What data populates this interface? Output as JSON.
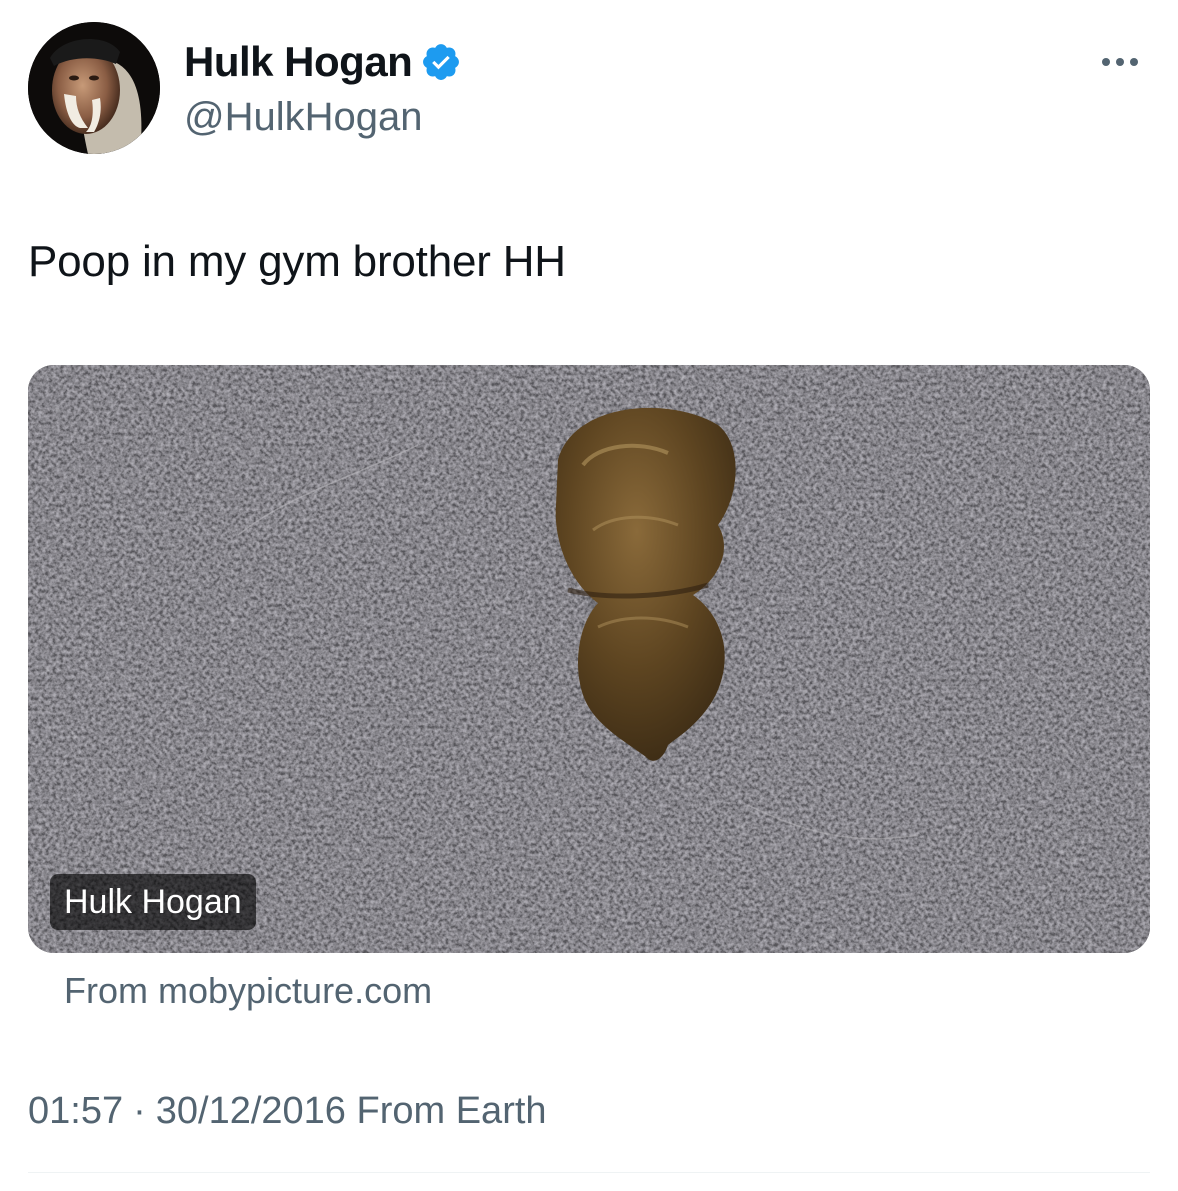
{
  "author": {
    "display_name": "Hulk Hogan",
    "handle": "@HulkHogan",
    "verified": true,
    "verified_color": "#1d9bf0"
  },
  "icons": {
    "verified": "verified-badge-icon",
    "more": "more-options-icon"
  },
  "tweet": {
    "text": "Poop in my gym brother HH"
  },
  "media": {
    "badge": "Hulk Hogan",
    "source": "From mobypicture.com"
  },
  "meta": {
    "time": "01:57",
    "separator": "·",
    "date": "30/12/2016",
    "via": "From Earth"
  },
  "colors": {
    "text_primary": "#0f1419",
    "text_secondary": "#536471",
    "divider": "#eff3f4"
  }
}
